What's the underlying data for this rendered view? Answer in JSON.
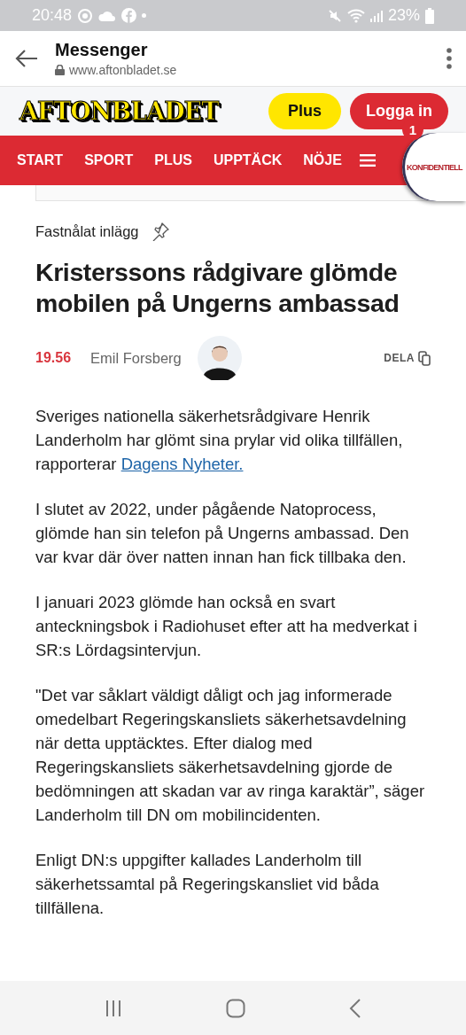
{
  "status_bar": {
    "time": "20:48",
    "battery": "23%"
  },
  "browser_bar": {
    "title": "Messenger",
    "url": "www.aftonbladet.se"
  },
  "site_header": {
    "logo": "AFTONBLADET",
    "buttons": [
      {
        "label": "Plus",
        "kind": "plus"
      },
      {
        "label": "Logga in",
        "kind": "login"
      }
    ]
  },
  "nav": {
    "items": [
      {
        "label": "START"
      },
      {
        "label": "SPORT"
      },
      {
        "label": "PLUS"
      },
      {
        "label": "UPPTÄCK"
      },
      {
        "label": "NÖJE"
      }
    ],
    "bubble": {
      "label": "KONFIDENTIELL",
      "count": "1"
    }
  },
  "article": {
    "pinned_label": "Fastnålat inlägg",
    "headline": "Kristerssons rådgivare glömde mobilen på Ungerns ambassad",
    "time": "19.56",
    "author": "Emil Forsberg",
    "share": "DELA",
    "paragraphs": [
      {
        "text": "Sveriges nationella säkerhetsrådgivare Henrik Landerholm har glömt sina prylar vid olika tillfällen, rapporterar ",
        "link": "Dagens Nyheter."
      },
      {
        "text": "I slutet av 2022, under pågående Natoprocess, glömde han sin telefon på Ungerns ambassad. Den var kvar där över natten innan han fick tillbaka den."
      },
      {
        "text": "I januari 2023 glömde han också en svart anteckningsbok i Radiohuset efter att ha medverkat i SR:s Lördagsintervjun."
      },
      {
        "text": "\"Det var såklart väldigt dåligt och jag informerade omedelbart Regeringskansliets säkerhetsavdelning när detta upptäcktes. Efter dialog med Regeringskansliets säkerhetsavdelning gjorde de bedömningen att skadan var av ringa karaktär”, säger Landerholm till DN om mobilincidenten."
      },
      {
        "text": "Enligt DN:s uppgifter kallades Landerholm till säkerhetssamtal på Regeringskansliet vid båda tillfällena."
      }
    ]
  }
}
